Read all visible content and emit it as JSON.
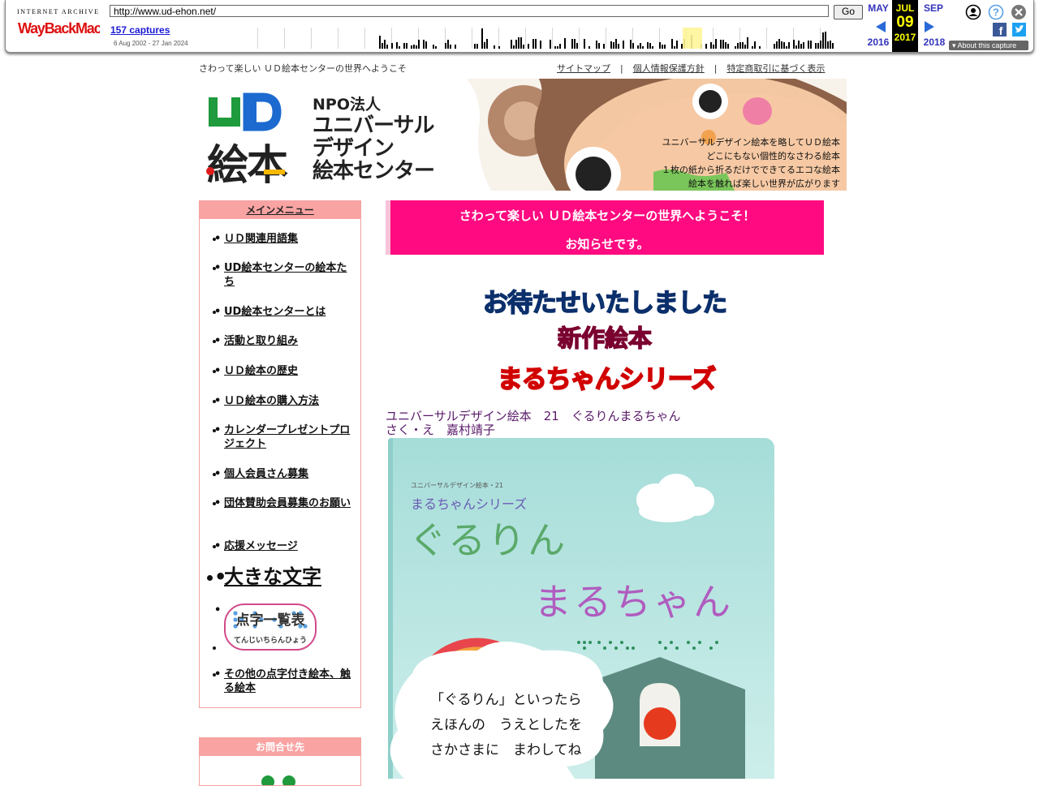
{
  "wayback": {
    "ia_label": "INTERNET ARCHIVE",
    "logo_text": "WayBackMachine",
    "url": "http://www.ud-ehon.net/",
    "go_label": "Go",
    "captures": "157 captures",
    "range": "6 Aug 2002 - 27 Jan 2024",
    "prev_month": "MAY",
    "prev_year": "2016",
    "cur_month": "JUL",
    "cur_day": "09",
    "cur_year": "2017",
    "next_month": "SEP",
    "next_year": "2018",
    "about": "About this capture"
  },
  "top": {
    "tagline": "さわって楽しい ＵＤ絵本センターの世界へようこそ",
    "links": [
      "サイトマップ",
      "個人情報保護方針",
      "特定商取引に基づく表示"
    ],
    "sep": "|"
  },
  "header": {
    "logo_ud": "UD",
    "logo_ehon": "絵本",
    "org_lines": [
      "NPO法人",
      "ユニバーサル",
      "デザイン",
      "絵本センター"
    ],
    "tagline_lines": [
      "ユニバーサルデザイン絵本を略してＵＤ絵本",
      "どこにもない個性的なさわる絵本",
      "１枚の紙から折るだけでできてるエコな絵本",
      "絵本を触れば楽しい世界が広がります"
    ]
  },
  "menu": {
    "title": "メインメニュー",
    "items": [
      "ＵＤ関連用語集",
      "UD絵本センターの絵本たち",
      "UD絵本センターとは",
      "活動と取り組み",
      "ＵＤ絵本の歴史",
      "ＵＤ絵本の購入方法",
      "カレンダープレゼントプロジェクト",
      "個人会員さん募集",
      "団体賛助会員募集のお願い",
      "応援メッセージ",
      "大きな文字",
      "その他の点字付き絵本、触る絵本"
    ],
    "tenji_title": "点字一覧表",
    "tenji_sub": "てんじいちらんひょう"
  },
  "contact": {
    "title": "お問合せ先"
  },
  "welcome": {
    "line1": "さわって楽しい ＵＤ絵本センターの世界へようこそ！",
    "line2": "お知らせです。"
  },
  "banner": {
    "line1": "お待たせいたしました",
    "line2": "新作絵本",
    "line3": "まるちゃんシリーズ"
  },
  "book": {
    "info_line1": "ユニバーサルデザイン絵本　21　ぐるりんまるちゃん",
    "info_line2": "さく・え　嘉村靖子",
    "cover_small": "ユニバーサルデザイン絵本・21",
    "cover_series": "まるちゃんシリーズ",
    "cover_title1": "ぐるりん",
    "cover_title2": "まるちゃん",
    "bubble_lines": [
      "「ぐるりん」といったら",
      "えほんの　うえとしたを",
      "さかさまに　まわしてね"
    ]
  }
}
